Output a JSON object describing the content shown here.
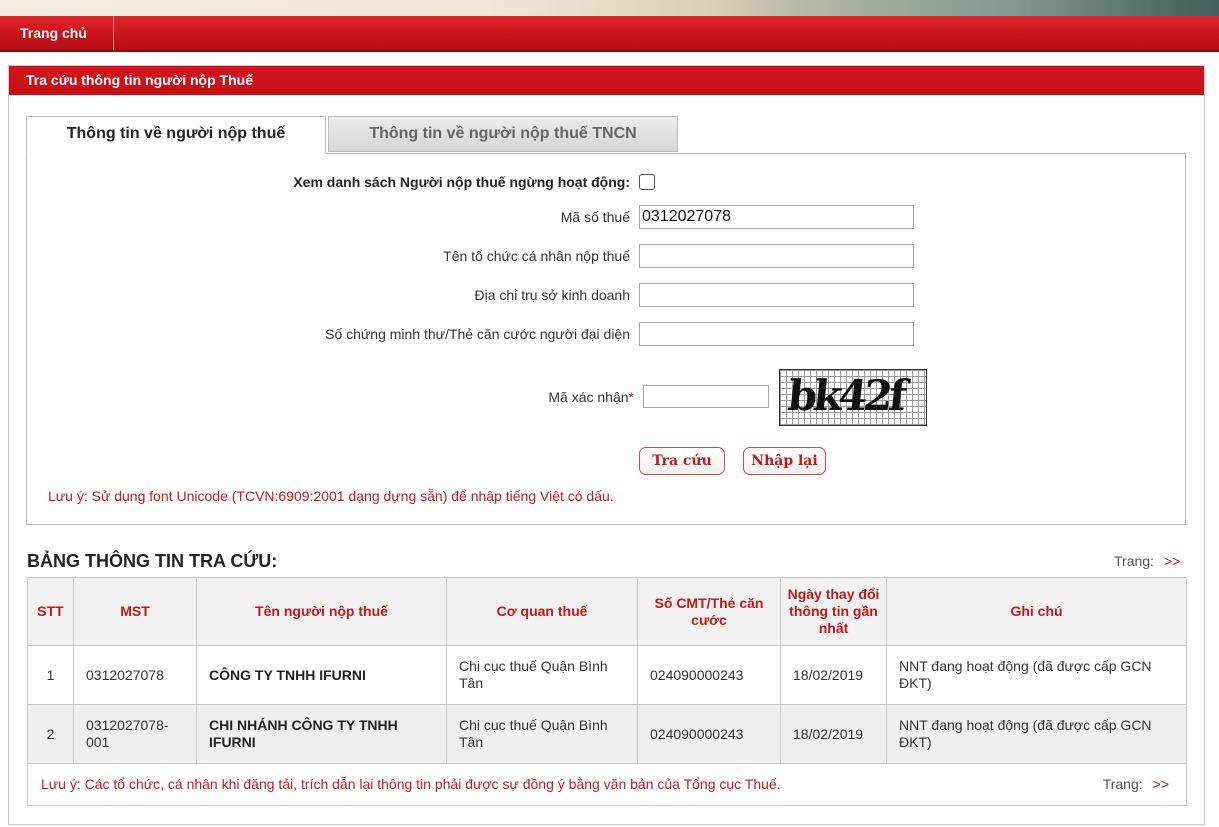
{
  "nav": {
    "home_label": "Trang chủ"
  },
  "panel": {
    "title": "Tra cứu thông tin người nộp Thuế"
  },
  "tabs": [
    {
      "label": "Thông tin về người nộp thuế",
      "active": true
    },
    {
      "label": "Thông tin về người nộp thuế TNCN",
      "active": false
    }
  ],
  "form": {
    "inactive_list_label": "Xem danh sách Người nộp thuế ngừng hoạt động:",
    "inactive_list_checked": false,
    "tax_code_label": "Mã số thuế",
    "tax_code_value": "0312027078",
    "name_label": "Tên tổ chức cá nhân nộp thuế",
    "name_value": "",
    "address_label": "Địa chỉ trụ sở kinh doanh",
    "address_value": "",
    "id_label": "Số chứng minh thư/Thẻ căn cước người đại diện",
    "id_value": "",
    "captcha_label": "Mã xác nhận",
    "captcha_required_mark": "*",
    "captcha_value": "",
    "captcha_image_text": "bk42f",
    "search_button": "Tra cứu",
    "reset_button": "Nhập lại",
    "note": "Lưu ý: Sử dụng font Unicode (TCVN:6909:2001 dạng dựng sẵn) để nhập tiếng Việt có dấu."
  },
  "results": {
    "title": "BẢNG THÔNG TIN TRA CỨU:",
    "pager_label": "Trang:",
    "pager_next": ">>",
    "columns": [
      "STT",
      "MST",
      "Tên người nộp thuế",
      "Cơ quan thuế",
      "Số CMT/Thẻ căn cước",
      "Ngày thay đổi thông tin gần nhất",
      "Ghi chú"
    ],
    "rows": [
      [
        "1",
        "0312027078",
        "CÔNG TY TNHH IFURNI",
        "Chi cục thuế Quận Bình Tân",
        "024090000243",
        "18/02/2019",
        "NNT đang hoạt động (đã được cấp GCN ĐKT)"
      ],
      [
        "2",
        "0312027078-001",
        "CHI NHÁNH CÔNG TY TNHH IFURNI",
        "Chi cục thuế Quận Bình Tân",
        "024090000243",
        "18/02/2019",
        "NNT đang hoạt động (đã được cấp GCN ĐKT)"
      ]
    ],
    "footer_note": "Lưu ý: Các tổ chức, cá nhân khi đăng tải, trích dẫn lại thông tin phải được sự đồng ý bằng văn bản của Tổng cục Thuế."
  },
  "colors": {
    "brand_red": "#c8121a",
    "link_red": "#c01a1a"
  }
}
